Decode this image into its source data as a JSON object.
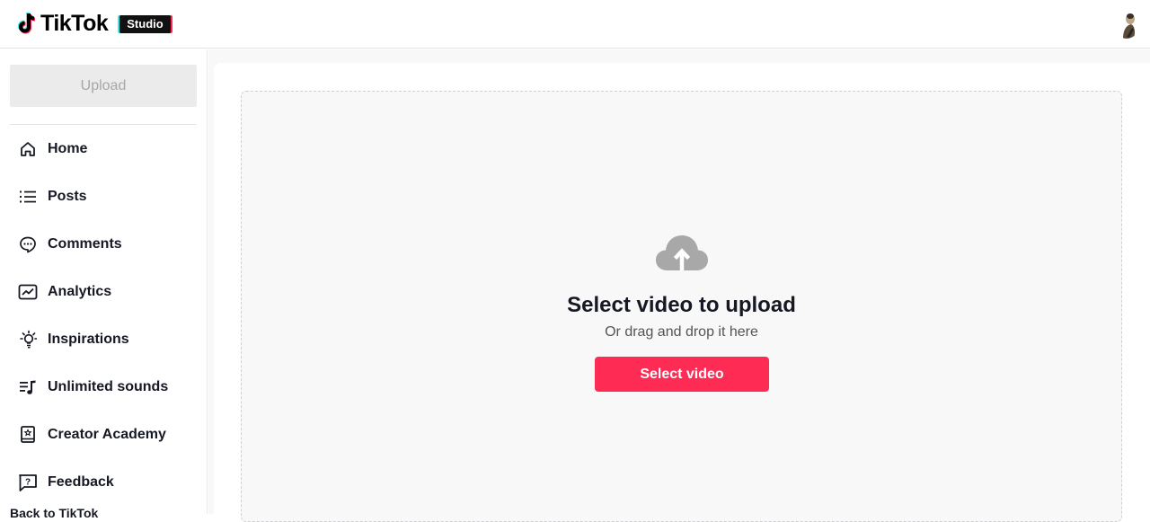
{
  "header": {
    "brand": "TikTok",
    "badge": "Studio",
    "avatar_alt": "profile-avatar"
  },
  "sidebar": {
    "upload_label": "Upload",
    "items": [
      {
        "label": "Home",
        "icon": "home-icon"
      },
      {
        "label": "Posts",
        "icon": "list-icon"
      },
      {
        "label": "Comments",
        "icon": "comment-icon"
      },
      {
        "label": "Analytics",
        "icon": "analytics-icon"
      },
      {
        "label": "Inspirations",
        "icon": "lightbulb-icon"
      },
      {
        "label": "Unlimited sounds",
        "icon": "music-list-icon"
      },
      {
        "label": "Creator Academy",
        "icon": "academy-book-icon"
      },
      {
        "label": "Feedback",
        "icon": "feedback-icon"
      }
    ],
    "back_label": "Back to TikTok"
  },
  "dropzone": {
    "icon": "cloud-upload-icon",
    "title": "Select video to upload",
    "subtitle": "Or drag and drop it here",
    "button_label": "Select video"
  },
  "colors": {
    "accent": "#fe2c55",
    "cyan": "#25f4ee",
    "upload_disabled_bg": "#ebebeb",
    "upload_disabled_text": "#a7a7ab",
    "cloud_icon": "#a8a8a8"
  }
}
